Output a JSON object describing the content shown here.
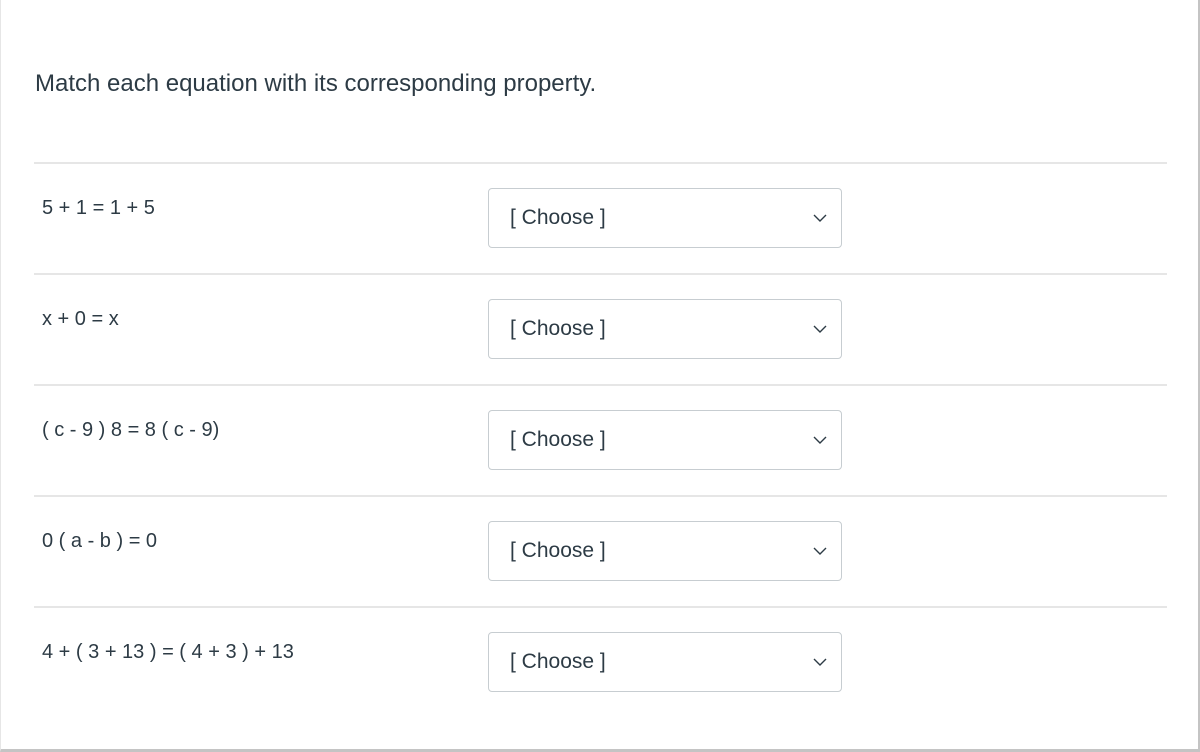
{
  "question": {
    "prompt": "Match each equation with its corresponding property."
  },
  "answers": [
    {
      "equation": "5 + 1 = 1 + 5",
      "selected": "[ Choose ]",
      "icon": "chevron-down-icon"
    },
    {
      "equation": "x + 0 = x",
      "selected": "[ Choose ]",
      "icon": "chevron-down-icon"
    },
    {
      "equation": "( c - 9 ) 8 = 8 ( c - 9)",
      "selected": "[ Choose ]",
      "icon": "chevron-down-icon"
    },
    {
      "equation": "0 ( a - b ) = 0",
      "selected": "[ Choose ]",
      "icon": "chevron-down-icon"
    },
    {
      "equation": "4 + ( 3 + 13 ) = ( 4 + 3 ) + 13",
      "selected": "[ Choose ]",
      "icon": "chevron-down-icon"
    }
  ],
  "colors": {
    "text": "#2d3b45",
    "separator": "#e6e6e6",
    "select_border": "#c7cdd1"
  }
}
